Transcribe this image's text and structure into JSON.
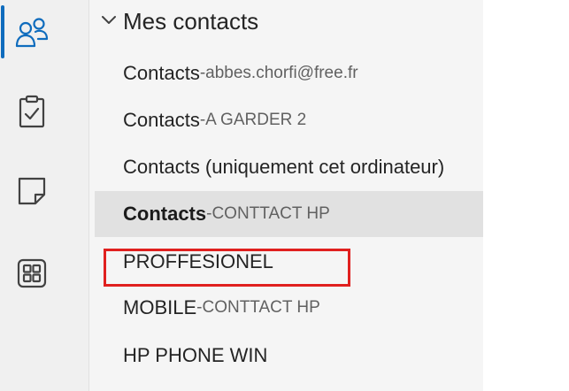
{
  "nav_rail": {
    "items": [
      {
        "icon": "people-icon",
        "active": true
      },
      {
        "icon": "clipboard-task-icon",
        "active": false
      },
      {
        "icon": "note-icon",
        "active": false
      },
      {
        "icon": "apps-grid-icon",
        "active": false
      }
    ],
    "accent_color": "#0f6cbd"
  },
  "folder_pane": {
    "group_title": "Mes contacts",
    "group_expanded_icon": "chevron-down-icon",
    "items": [
      {
        "label": "Contacts",
        "separator": " - ",
        "account": "abbes.chorfi@free.fr",
        "selected": false
      },
      {
        "label": "Contacts",
        "separator": " - ",
        "account": "A GARDER 2",
        "selected": false
      },
      {
        "label": "Contacts (uniquement cet ordinateur)",
        "separator": "",
        "account": "",
        "selected": false
      },
      {
        "label": "Contacts",
        "separator": " - ",
        "account": "CONTTACT HP",
        "selected": true
      },
      {
        "label": "PROFFESIONEL",
        "separator": "",
        "account": "",
        "selected": false,
        "highlighted": true
      },
      {
        "label": "MOBILE",
        "separator": " - ",
        "account": "CONTTACT HP",
        "selected": false
      },
      {
        "label": "HP PHONE WIN",
        "separator": "",
        "account": "",
        "selected": false
      }
    ]
  },
  "annotation": {
    "highlight_color": "#e0201f"
  }
}
